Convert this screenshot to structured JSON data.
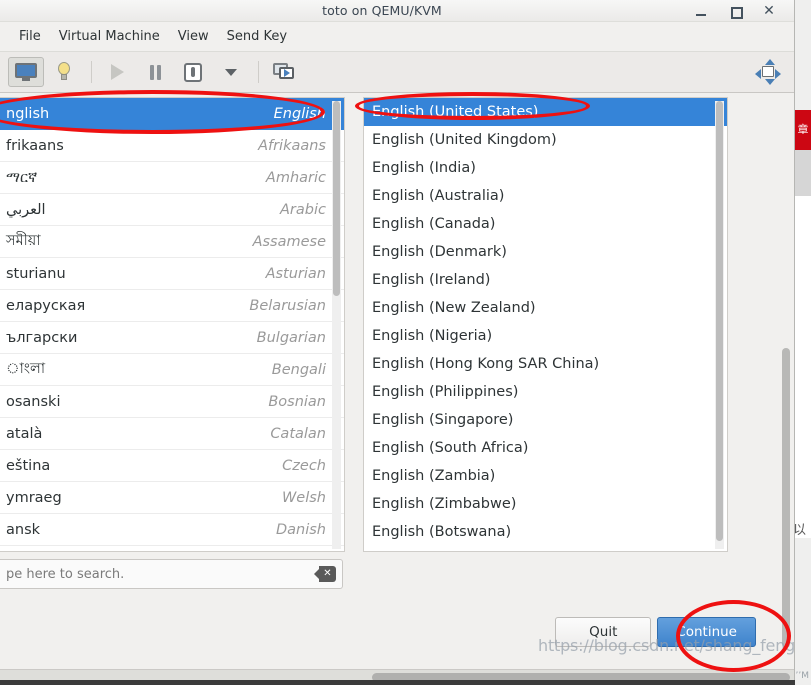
{
  "window": {
    "title": "toto on QEMU/KVM",
    "minimize_label": "–",
    "maximize_label": "□",
    "close_label": "✕"
  },
  "menubar": {
    "items": [
      {
        "label": "File"
      },
      {
        "label": "Virtual Machine"
      },
      {
        "label": "View"
      },
      {
        "label": "Send Key"
      }
    ]
  },
  "toolbar": {
    "items": [
      {
        "name": "show-console-button",
        "icon": "monitor-icon"
      },
      {
        "name": "show-details-button",
        "icon": "lightbulb-icon"
      },
      {
        "name": "run-button",
        "icon": "play-icon"
      },
      {
        "name": "pause-button",
        "icon": "pause-icon"
      },
      {
        "name": "shutdown-button",
        "icon": "power-icon"
      },
      {
        "name": "shutdown-menu-button",
        "icon": "chevron-down-icon"
      },
      {
        "name": "snapshots-button",
        "icon": "snapshots-icon"
      }
    ],
    "fullscreen": {
      "name": "fullscreen-button",
      "icon": "fullscreen-icon"
    }
  },
  "installer": {
    "language_list": {
      "rows": [
        {
          "native": "nglish",
          "english": "English",
          "selected": true,
          "chevron": "›"
        },
        {
          "native": "frikaans",
          "english": "Afrikaans",
          "selected": false
        },
        {
          "native": "ማርኛ",
          "english": "Amharic",
          "selected": false
        },
        {
          "native": "العربي",
          "english": "Arabic",
          "selected": false
        },
        {
          "native": "সমীয়া",
          "english": "Assamese",
          "selected": false
        },
        {
          "native": "sturianu",
          "english": "Asturian",
          "selected": false
        },
        {
          "native": "еларуская",
          "english": "Belarusian",
          "selected": false
        },
        {
          "native": "ългарски",
          "english": "Bulgarian",
          "selected": false
        },
        {
          "native": "াংলা",
          "english": "Bengali",
          "selected": false
        },
        {
          "native": "osanski",
          "english": "Bosnian",
          "selected": false
        },
        {
          "native": "atalà",
          "english": "Catalan",
          "selected": false
        },
        {
          "native": "eština",
          "english": "Czech",
          "selected": false
        },
        {
          "native": "ymraeg",
          "english": "Welsh",
          "selected": false
        },
        {
          "native": "ansk",
          "english": "Danish",
          "selected": false
        }
      ]
    },
    "search": {
      "placeholder": "pe here to search.",
      "clear_icon": "clear-icon",
      "clear_glyph": "✕"
    },
    "locale_list": {
      "rows": [
        {
          "label": "English (United States)",
          "selected": true
        },
        {
          "label": "English (United Kingdom)",
          "selected": false
        },
        {
          "label": "English (India)",
          "selected": false
        },
        {
          "label": "English (Australia)",
          "selected": false
        },
        {
          "label": "English (Canada)",
          "selected": false
        },
        {
          "label": "English (Denmark)",
          "selected": false
        },
        {
          "label": "English (Ireland)",
          "selected": false
        },
        {
          "label": "English (New Zealand)",
          "selected": false
        },
        {
          "label": "English (Nigeria)",
          "selected": false
        },
        {
          "label": "English (Hong Kong SAR China)",
          "selected": false
        },
        {
          "label": "English (Philippines)",
          "selected": false
        },
        {
          "label": "English (Singapore)",
          "selected": false
        },
        {
          "label": "English (South Africa)",
          "selected": false
        },
        {
          "label": "English (Zambia)",
          "selected": false
        },
        {
          "label": "English (Zimbabwe)",
          "selected": false
        },
        {
          "label": "English (Botswana)",
          "selected": false
        }
      ]
    },
    "buttons": {
      "quit": "Quit",
      "continue": "Continue"
    }
  },
  "background": {
    "red_block_text": "章",
    "cjk_text": "以"
  },
  "watermark": {
    "text": "https://blog.csdn.net/shang_feng_wei",
    "corner": "’’M"
  },
  "colors": {
    "selection_blue": "#3584d8",
    "primary_button": "#3f83cc",
    "annotation_red": "#ee1111",
    "window_chrome": "#f1f0ee"
  }
}
